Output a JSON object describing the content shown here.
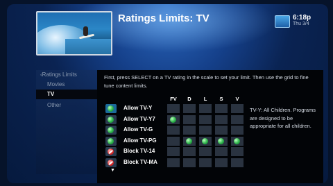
{
  "header": {
    "title": "Ratings Limits: TV",
    "time": "6:18p",
    "date": "Thu 3/4"
  },
  "sidebar": {
    "breadcrumb": "‹Ratings Limits",
    "items": [
      {
        "label": "Movies",
        "selected": false
      },
      {
        "label": "TV",
        "selected": true
      },
      {
        "label": "Other",
        "selected": false
      }
    ]
  },
  "panel": {
    "instruction": "First, press SELECT on a TV rating in the scale to set your limit. Then use the grid to fine tune content limits.",
    "columns": [
      "FV",
      "D",
      "L",
      "S",
      "V"
    ],
    "rows": [
      {
        "label": "Allow TV-Y",
        "status": "allow",
        "selected": true,
        "cells": [
          false,
          false,
          false,
          false,
          false
        ]
      },
      {
        "label": "Allow TV-Y7",
        "status": "allow",
        "selected": false,
        "cells": [
          true,
          false,
          false,
          false,
          false
        ]
      },
      {
        "label": "Allow TV-G",
        "status": "allow",
        "selected": false,
        "cells": [
          false,
          false,
          false,
          false,
          false
        ]
      },
      {
        "label": "Allow TV-PG",
        "status": "allow",
        "selected": false,
        "cells": [
          false,
          true,
          true,
          true,
          true
        ]
      },
      {
        "label": "Block TV-14",
        "status": "block",
        "selected": false,
        "cells": [
          false,
          false,
          false,
          false,
          false
        ]
      },
      {
        "label": "Block TV-MA",
        "status": "block",
        "selected": false,
        "cells": [
          false,
          false,
          false,
          false,
          false
        ]
      }
    ],
    "scroll_indicator": "▼",
    "description": "TV-Y: All Children. Programs are designed to be appropriate for all children."
  },
  "icons": {
    "status": "tv-guide-icon",
    "allow": "green-check-dot-icon",
    "block": "red-block-icon"
  }
}
